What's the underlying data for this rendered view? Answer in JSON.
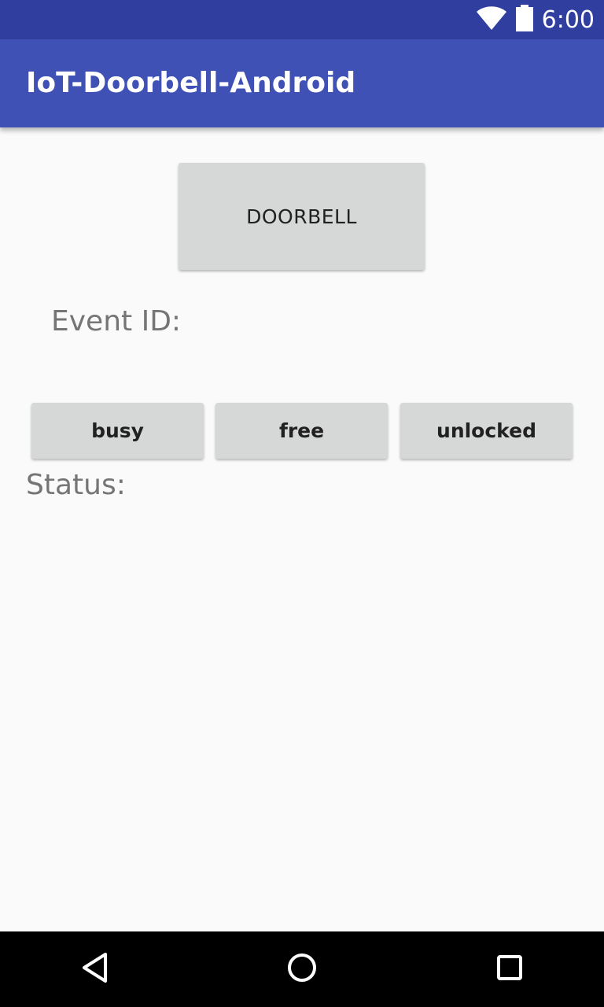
{
  "status_bar": {
    "time": "6:00",
    "icons": [
      "wifi-icon",
      "battery-icon"
    ],
    "color": "#303f9f"
  },
  "app_bar": {
    "title": "IoT-Doorbell-Android",
    "color": "#3f51b5"
  },
  "main": {
    "doorbell_button_label": "DOORBELL",
    "event_id_label": "Event ID:",
    "status_buttons": {
      "busy": "busy",
      "free": "free",
      "unlocked": "unlocked"
    },
    "status_label": "Status:"
  },
  "nav_bar": {
    "icons": [
      "back-icon",
      "home-icon",
      "recents-icon"
    ]
  }
}
